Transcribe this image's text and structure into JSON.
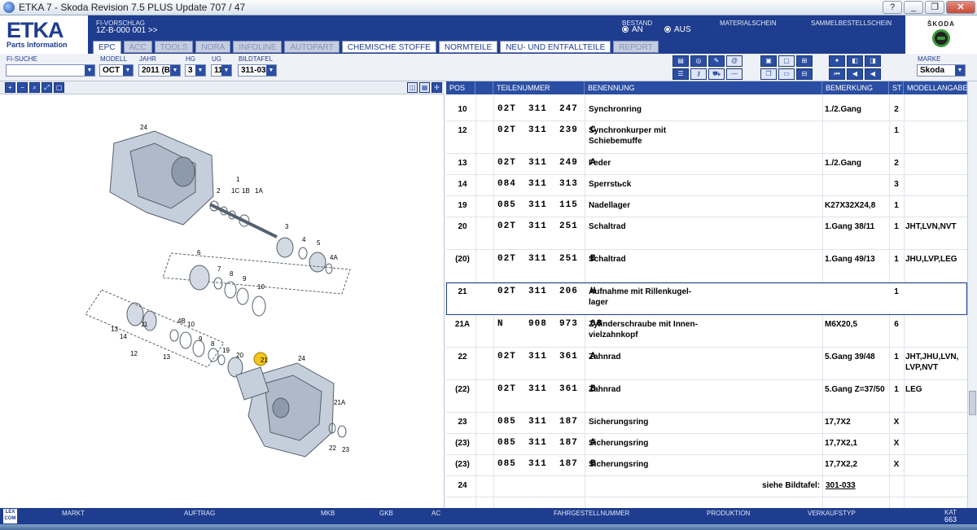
{
  "window": {
    "title": "ETKA 7 - Skoda Revision 7.5 PLUS Update 707 / 47",
    "buttons": [
      "?",
      "_",
      "❐",
      "✕"
    ]
  },
  "logo": {
    "big": "ETKA",
    "small": "Parts Information"
  },
  "header": {
    "fi_vorschlag_label": "FI-VORSCHLAG",
    "fi_vorschlag_value": "1Z-B-000 001 >>",
    "bestand_label": "BESTAND",
    "bestand_an": "AN",
    "bestand_aus": "AUS",
    "materialschein": "MATERIALSCHEIN",
    "sammelbestellschein": "SAMMELBESTELLSCHEIN",
    "brand": "ŠKODA"
  },
  "tabs": [
    {
      "label": "EPC",
      "state": "active"
    },
    {
      "label": "ACC",
      "state": "dis"
    },
    {
      "label": "TOOLS",
      "state": "dis"
    },
    {
      "label": "NORA",
      "state": "dis"
    },
    {
      "label": "INFOLINE",
      "state": "dis"
    },
    {
      "label": "AUTOPART",
      "state": "dis"
    },
    {
      "label": "CHEMISCHE STOFFE",
      "state": "dark"
    },
    {
      "label": "NORMTEILE",
      "state": "dark"
    },
    {
      "label": "NEU- UND ENTFALLTEILE",
      "state": "dark"
    },
    {
      "label": "REPORT",
      "state": "dis"
    }
  ],
  "filters": {
    "fi_suche_label": "FI-SUCHE",
    "modell_label": "MODELL",
    "modell_value": "OCT",
    "jahr_label": "JAHR",
    "jahr_value": "2011 (B)",
    "hg_label": "HG",
    "hg_value": "3",
    "ug_label": "UG",
    "ug_value": "11",
    "bildtafel_label": "BILDTAFEL",
    "bildtafel_value": "311-033",
    "marke_label": "MARKE",
    "marke_value": "Skoda"
  },
  "table": {
    "headers": [
      "POS",
      "TEILENUMMER",
      "BENENNUNG",
      "BEMERKUNG",
      "ST",
      "MODELLANGABE"
    ],
    "rows": [
      {
        "pos": "10",
        "num": "02T  311  247",
        "ben": "Synchronring",
        "bem": "1./2.Gang",
        "st": "2",
        "mod": "",
        "h": 26
      },
      {
        "pos": "12",
        "num": "02T  311  239  C",
        "ben": "Synchronkurper mit Schiebemuffe",
        "bem": "",
        "st": "1",
        "mod": "",
        "h": 40
      },
      {
        "pos": "13",
        "num": "02T  311  249  A",
        "ben": "Feder",
        "bem": "1./2.Gang",
        "st": "2",
        "mod": "",
        "h": 26
      },
      {
        "pos": "14",
        "num": "084  311  313",
        "ben": "Sperrstьck",
        "bem": "",
        "st": "3",
        "mod": "",
        "h": 26
      },
      {
        "pos": "19",
        "num": "085  311  115",
        "ben": "Nadellager",
        "bem": "K27X32X24,8",
        "st": "1",
        "mod": "",
        "h": 26
      },
      {
        "pos": "20",
        "num": "02T  311  251",
        "ben": "Schaltrad",
        "bem": "1.Gang 38/11",
        "st": "1",
        "mod": "JHT,LVN,NVT",
        "h": 40
      },
      {
        "pos": "(20)",
        "num": "02T  311  251  B",
        "ben": "Schaltrad",
        "bem": "1.Gang 49/13",
        "st": "1",
        "mod": "JHU,LVP,LEG",
        "h": 40
      },
      {
        "pos": "21",
        "num": "02T  311  206  H",
        "ben": "Aufnahme mit Rillenkugel- lager",
        "bem": "",
        "st": "1",
        "mod": "",
        "h": 40,
        "sel": true
      },
      {
        "pos": "21A",
        "num": "N    908  973  08",
        "ben": "Zylinderschraube mit Innen- vielzahnkopf",
        "bem": "M6X20,5",
        "st": "6",
        "mod": "",
        "h": 40
      },
      {
        "pos": "22",
        "num": "02T  311  361  A",
        "ben": "Zahnrad",
        "bem": "5.Gang 39/48",
        "st": "1",
        "mod": "JHT,JHU,LVN, LVP,NVT",
        "h": 40
      },
      {
        "pos": "(22)",
        "num": "02T  311  361  B",
        "ben": "Zahnrad",
        "bem": "5.Gang Z=37/50",
        "st": "1",
        "mod": "LEG",
        "h": 40
      },
      {
        "pos": "23",
        "num": "085  311  187",
        "ben": "Sicherungsring",
        "bem": "17,7X2",
        "st": "X",
        "mod": "",
        "h": 26
      },
      {
        "pos": "(23)",
        "num": "085  311  187  A",
        "ben": "Sicherungsring",
        "bem": "17,7X2,1",
        "st": "X",
        "mod": "",
        "h": 26
      },
      {
        "pos": "(23)",
        "num": "085  311  187  B",
        "ben": "Sicherungsring",
        "bem": "17,7X2,2",
        "st": "X",
        "mod": "",
        "h": 26
      },
      {
        "pos": "24",
        "num": "",
        "ben": "",
        "bem": "",
        "st": "",
        "mod": "",
        "h": 26,
        "siehe": "siehe Bildtafel:",
        "link": "301-033"
      }
    ]
  },
  "diagram": {
    "callouts": [
      "24",
      "1",
      "2",
      "1C",
      "1B",
      "1A",
      "3",
      "4",
      "5",
      "4A",
      "6",
      "7",
      "8",
      "9",
      "10",
      "14",
      "13",
      "11",
      "12",
      "13",
      "4B",
      "10",
      "9",
      "8",
      "19",
      "20",
      "21",
      "24",
      "21A",
      "22",
      "23"
    ]
  },
  "bottom": {
    "logo": "LEX COM",
    "items": [
      "MARKT",
      "AUFTRAG",
      "MKB",
      "GKB",
      "AC",
      "FAHRGESTELLNUMMER",
      "PRODUKTION",
      "VERKAUFSTYP"
    ],
    "kat_label": "KAT",
    "kat_value": "663"
  }
}
